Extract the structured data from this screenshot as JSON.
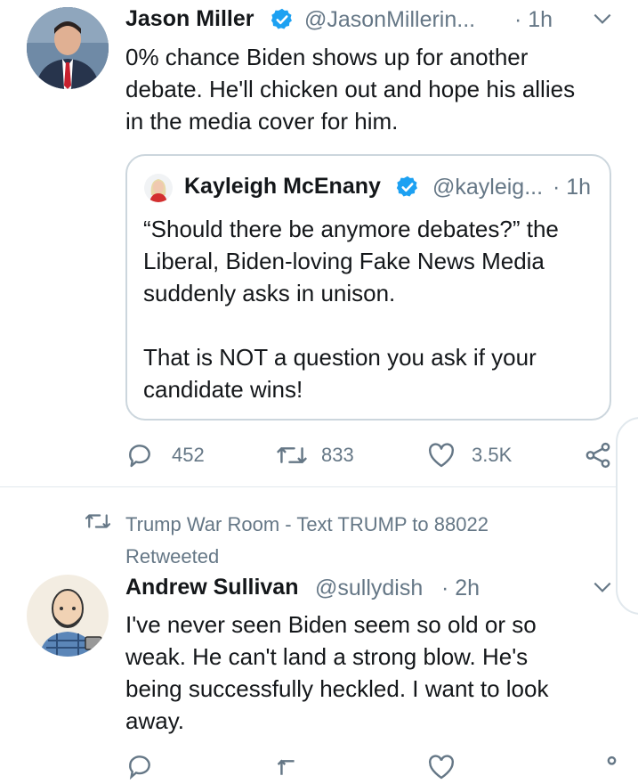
{
  "tweet1": {
    "author": "Jason Miller",
    "handle": "@JasonMillerin...",
    "time": "· 1h",
    "text_lines": [
      "0% chance Biden shows up for another",
      "debate. He'll chicken out and hope his allies",
      "in the media cover for him."
    ],
    "quote": {
      "author": "Kayleigh McEnany",
      "handle": "@kayleig...",
      "time": "· 1h",
      "text_lines": [
        "“Should there be anymore debates?” the",
        "Liberal, Biden-loving Fake News Media",
        "suddenly asks in unison.",
        "",
        "That is NOT a question you ask if your",
        "candidate wins!"
      ]
    },
    "actions": {
      "replies": "452",
      "retweets": "833",
      "likes": "3.5K"
    }
  },
  "retweet_banner": {
    "line1": "Trump War Room - Text TRUMP to 88022",
    "line2": "Retweeted"
  },
  "tweet2": {
    "author": "Andrew Sullivan",
    "handle": "@sullydish",
    "time": "· 2h",
    "text_lines": [
      "I've never seen Biden seem so old or so",
      "weak. He can't land a strong blow. He's",
      "being successfully heckled. I want to look",
      "away."
    ]
  },
  "colors": {
    "verified": "#1da1f2",
    "secondary": "#657786",
    "divider": "#e1e8ed"
  },
  "icons": [
    "verified-icon",
    "chevron-down-icon",
    "reply-icon",
    "retweet-icon",
    "like-icon",
    "share-icon"
  ]
}
